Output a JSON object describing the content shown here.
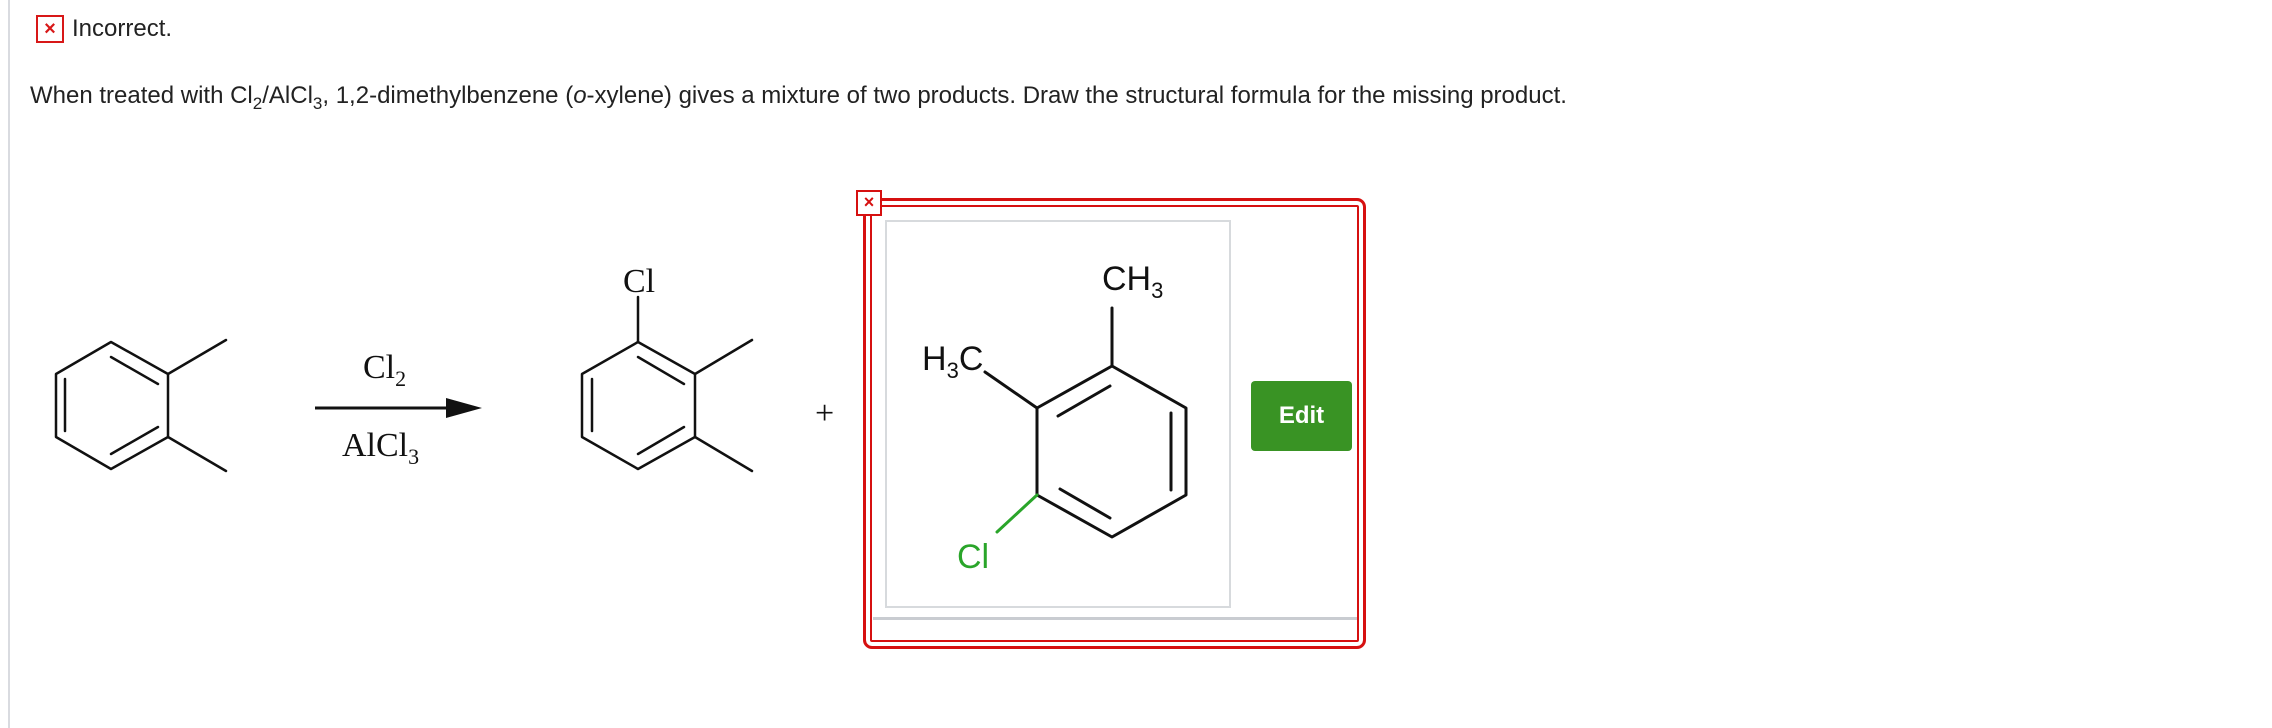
{
  "status": {
    "icon": "red-x-icon",
    "text": "Incorrect."
  },
  "question": {
    "prefix": "When treated with Cl",
    "sub1": "2",
    "slash": "/AlCl",
    "sub2": "3",
    "middle": ", 1,2-dimethylbenzene (",
    "italic": "o",
    "suffix": "-xylene) gives a mixture of two products. Draw the structural formula for the missing product."
  },
  "reaction": {
    "reagent_top_base": "Cl",
    "reagent_top_sub": "2",
    "reagent_bottom_base": "AlCl",
    "reagent_bottom_sub": "3",
    "product_label": "Cl",
    "plus": "+"
  },
  "answer": {
    "methyl_top_base": "CH",
    "methyl_top_sub": "3",
    "methyl_left_h": "H",
    "methyl_left_sub": "3",
    "methyl_left_c": "C",
    "chlorine": "Cl",
    "wrong_marker": "×"
  },
  "edit_button": {
    "label": "Edit"
  },
  "colors": {
    "incorrect": "#d81818",
    "chlorine_green": "#2aa52a",
    "edit_button": "#399324"
  }
}
